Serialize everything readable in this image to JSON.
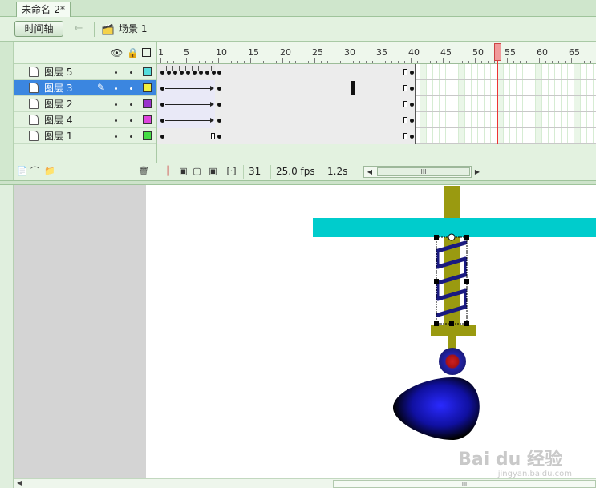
{
  "document_tab": {
    "title": "未命名-2*"
  },
  "toolbar": {
    "timeline_button": "时间轴",
    "back_arrow": "←",
    "scene_label": "场景 1"
  },
  "timeline": {
    "header_icons": {
      "eye": "eye-icon",
      "lock": "lock-icon",
      "outline": "outline-icon"
    },
    "ruler_labels": [
      "1",
      "5",
      "10",
      "15",
      "20",
      "25",
      "30",
      "35",
      "40",
      "45",
      "50",
      "55",
      "60",
      "65"
    ],
    "layers": [
      {
        "name": "图层 5",
        "color": "#55dddd",
        "selected": false
      },
      {
        "name": "图层 3",
        "color": "#f0f040",
        "selected": true
      },
      {
        "name": "图层 2",
        "color": "#9933cc",
        "selected": false
      },
      {
        "name": "图层 4",
        "color": "#dd44dd",
        "selected": false
      },
      {
        "name": "图层 1",
        "color": "#44dd44",
        "selected": false
      }
    ],
    "current_frame": "31",
    "frame_rate": "25.0 fps",
    "elapsed_time": "1.2s",
    "scroll_thumb_label": "III"
  },
  "stage": {
    "watermark_text": "Bai du 经验",
    "watermark_sub": "jingyan.baidu.com"
  },
  "bottom_scroll": {
    "thumb_label": "III"
  }
}
